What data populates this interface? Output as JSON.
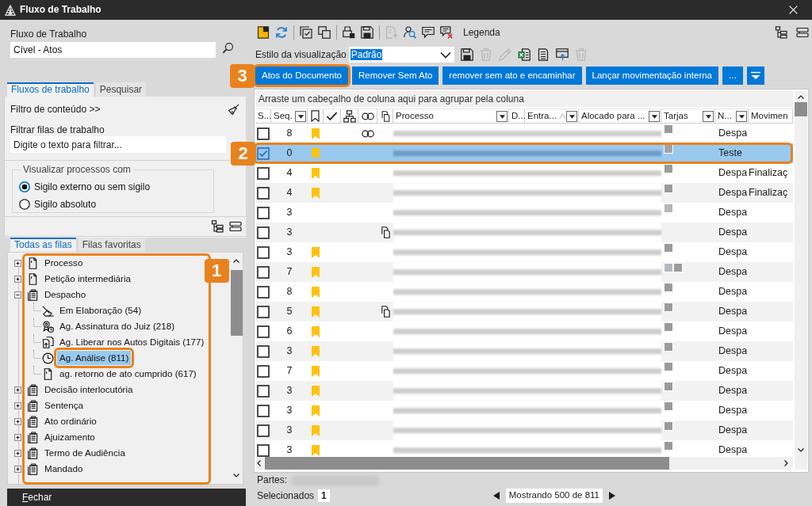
{
  "window": {
    "title": "Fluxo de Trabalho"
  },
  "workflow": {
    "label": "Fluxo de Trabalho",
    "value": "Cível - Atos"
  },
  "left_tabs": [
    {
      "label": "Fluxos de trabalho",
      "selected": true
    },
    {
      "label": "Pesquisar",
      "selected": false
    }
  ],
  "content_filter": {
    "label": "Filtro de conteúdo >>"
  },
  "queue_filter": {
    "label": "Filtrar filas de trabalho",
    "placeholder": "Digite o texto para filtrar..."
  },
  "visibility_group": {
    "legend": "Visualizar processos com",
    "options": [
      {
        "label": "Sigilo externo ou sem sigilo",
        "selected": true
      },
      {
        "label": "Sigilo absoluto",
        "selected": false
      }
    ]
  },
  "queue_tabs": [
    {
      "label": "Todas as filas",
      "selected": true
    },
    {
      "label": "Filas favoritas",
      "selected": false
    }
  ],
  "queue_tree": {
    "callout": "1",
    "items": [
      {
        "label": "Processo",
        "kind": "document",
        "expanded": false,
        "selected": false,
        "outlined": false
      },
      {
        "label": "Petição intermediária",
        "kind": "document",
        "expanded": false,
        "selected": false,
        "outlined": false
      },
      {
        "label": "Despacho",
        "kind": "clipboard",
        "expanded": true,
        "selected": false,
        "outlined": false,
        "children": [
          {
            "label": "Em Elaboração (54)",
            "kind": "draft",
            "selected": false,
            "outlined": false
          },
          {
            "label": "Ag. Assinatura do Juiz (218)",
            "kind": "signature",
            "selected": false,
            "outlined": false
          },
          {
            "label": "Ag. Liberar nos Autos Digitais (177)",
            "kind": "upload",
            "selected": false,
            "outlined": false
          },
          {
            "label": "Ag. Análise (811)",
            "kind": "clock",
            "selected": true,
            "outlined": true
          },
          {
            "label": "ag. retorno de ato cumprido (617)",
            "kind": "document",
            "selected": false,
            "outlined": false
          }
        ]
      },
      {
        "label": "Decisão interlocutória",
        "kind": "clipboard",
        "expanded": false,
        "selected": false,
        "outlined": false
      },
      {
        "label": "Sentença",
        "kind": "clipboard",
        "expanded": false,
        "selected": false,
        "outlined": false
      },
      {
        "label": "Ato ordinário",
        "kind": "clipboard",
        "expanded": false,
        "selected": false,
        "outlined": false
      },
      {
        "label": "Ajuizamento",
        "kind": "clipboard",
        "expanded": false,
        "selected": false,
        "outlined": false
      },
      {
        "label": "Termo de Audiência",
        "kind": "clipboard",
        "expanded": false,
        "selected": false,
        "outlined": false
      },
      {
        "label": "Mandado",
        "kind": "clipboard",
        "expanded": false,
        "selected": false,
        "outlined": false
      }
    ]
  },
  "footer": {
    "close_label": "Fechar"
  },
  "toolbar": [
    {
      "kind": "new",
      "disabled": false
    },
    {
      "kind": "refresh",
      "disabled": false
    },
    {
      "kind": "separator"
    },
    {
      "kind": "checklist",
      "disabled": false
    },
    {
      "kind": "windows",
      "disabled": false
    },
    {
      "kind": "separator"
    },
    {
      "kind": "print",
      "disabled": false
    },
    {
      "kind": "save",
      "disabled": false
    },
    {
      "kind": "separator"
    },
    {
      "kind": "export",
      "disabled": true
    },
    {
      "kind": "inspect",
      "disabled": false
    },
    {
      "kind": "comment",
      "disabled": false
    },
    {
      "kind": "uncomment",
      "disabled": false
    },
    {
      "kind": "label",
      "text": "Legenda"
    }
  ],
  "view_style": {
    "label": "Estilo da visualização",
    "value": "Padrão",
    "tools": [
      {
        "kind": "save",
        "disabled": false
      },
      {
        "kind": "delete",
        "disabled": true
      },
      {
        "kind": "edit",
        "disabled": true
      },
      {
        "kind": "excel",
        "disabled": false
      },
      {
        "kind": "document",
        "disabled": false
      },
      {
        "kind": "window",
        "disabled": false
      },
      {
        "kind": "delete",
        "disabled": true
      }
    ]
  },
  "action_buttons": [
    {
      "label": "Atos do Documento",
      "callout": "3"
    },
    {
      "label": "Remover Sem Ato"
    },
    {
      "label": "remover sem ato e encaminhar"
    },
    {
      "label": "Lançar movimentação interna"
    },
    {
      "label": "..."
    }
  ],
  "grid": {
    "group_hint": "Arraste um cabeçalho de coluna aqui para agrupar pela coluna",
    "columns": [
      {
        "kind": "text",
        "label": "S...",
        "filter": false,
        "sorted": false
      },
      {
        "kind": "text",
        "label": "Seq.",
        "filter": true,
        "sorted": false
      },
      {
        "kind": "bookmark",
        "filter": false,
        "sorted": false
      },
      {
        "kind": "check",
        "filter": false,
        "sorted": false
      },
      {
        "kind": "hierarchy",
        "filter": false,
        "sorted": false
      },
      {
        "kind": "link",
        "filter": false,
        "sorted": false
      },
      {
        "kind": "copy",
        "filter": false,
        "sorted": false
      },
      {
        "kind": "text",
        "label": "Processo",
        "filter": true,
        "sorted": false
      },
      {
        "kind": "text",
        "label": "D...",
        "filter": false,
        "sorted": false
      },
      {
        "kind": "text",
        "label": "Entra...",
        "filter": true,
        "sorted": true
      },
      {
        "kind": "text",
        "label": "Alocado para ...",
        "filter": true,
        "sorted": false
      },
      {
        "kind": "text",
        "label": "Tarjas",
        "filter": true,
        "sorted": false
      },
      {
        "kind": "text",
        "label": "N...",
        "filter": true,
        "sorted": false
      },
      {
        "kind": "text",
        "label": "Movimen",
        "filter": false,
        "sorted": false
      }
    ],
    "rows": [
      {
        "checked": false,
        "selected": false,
        "seq": "8",
        "bookmarked": true,
        "link": true,
        "copy": false,
        "tarjas": [
          {
            "color": "#9b9b9b"
          }
        ],
        "n": "Despa"
      },
      {
        "checked": true,
        "selected": true,
        "callout": "2",
        "seq": "0",
        "bookmarked": true,
        "link": false,
        "copy": false,
        "tarjas": [
          {
            "color": "#a3a3a3"
          }
        ],
        "n": "Teste"
      },
      {
        "checked": false,
        "selected": false,
        "seq": "4",
        "bookmarked": true,
        "link": false,
        "copy": false,
        "tarjas": [
          {
            "color": "#9b9b9b"
          }
        ],
        "n": "Despa",
        "movimen": "Finalizaç"
      },
      {
        "checked": false,
        "selected": false,
        "seq": "4",
        "bookmarked": true,
        "link": false,
        "copy": false,
        "tarjas": [
          {
            "color": "#9b9b9b"
          }
        ],
        "n": "Despa",
        "movimen": "Finalizaç"
      },
      {
        "checked": false,
        "selected": false,
        "seq": "3",
        "bookmarked": false,
        "link": false,
        "copy": false,
        "tarjas": [
          {
            "color": "#b3b8bd"
          }
        ],
        "n": "Despa"
      },
      {
        "checked": false,
        "selected": false,
        "seq": "3",
        "bookmarked": false,
        "link": false,
        "copy": true,
        "n": "Despa"
      },
      {
        "checked": false,
        "selected": false,
        "seq": "3",
        "bookmarked": true,
        "link": false,
        "copy": false,
        "tarjas": [
          {
            "color": "#9b9b9b"
          }
        ],
        "n": "Despa"
      },
      {
        "checked": false,
        "selected": false,
        "seq": "7",
        "bookmarked": true,
        "link": false,
        "copy": false,
        "tarjas": [
          {
            "color": "#b3b8bd"
          },
          {
            "color": "#9b9b9b"
          }
        ],
        "n": "Despa"
      },
      {
        "checked": false,
        "selected": false,
        "seq": "8",
        "bookmarked": true,
        "link": false,
        "copy": false,
        "tarjas": [
          {
            "color": "#9b9b9b"
          }
        ],
        "n": "Despa"
      },
      {
        "checked": false,
        "selected": false,
        "seq": "5",
        "bookmarked": true,
        "link": false,
        "copy": true,
        "tarjas": [
          {
            "color": "#9b9b9b"
          }
        ],
        "n": "Despa"
      },
      {
        "checked": false,
        "selected": false,
        "seq": "6",
        "bookmarked": true,
        "link": false,
        "copy": false,
        "tarjas": [
          {
            "color": "#9b9b9b"
          }
        ],
        "n": "Despa"
      },
      {
        "checked": false,
        "selected": false,
        "seq": "3",
        "bookmarked": true,
        "link": false,
        "copy": false,
        "tarjas": [
          {
            "color": "#9b9b9b"
          }
        ],
        "n": "Despa"
      },
      {
        "checked": false,
        "selected": false,
        "seq": "7",
        "bookmarked": true,
        "link": false,
        "copy": false,
        "tarjas": [
          {
            "color": "#9b9b9b"
          }
        ],
        "n": "Despa"
      },
      {
        "checked": false,
        "selected": false,
        "seq": "3",
        "bookmarked": true,
        "link": false,
        "copy": false,
        "tarjas": [
          {
            "color": "#9b9b9b"
          }
        ],
        "n": "Despa"
      },
      {
        "checked": false,
        "selected": false,
        "seq": "3",
        "bookmarked": true,
        "link": false,
        "copy": false,
        "tarjas": [
          {
            "color": "#9b9b9b"
          }
        ],
        "n": "Despa"
      },
      {
        "checked": false,
        "selected": false,
        "seq": "3",
        "bookmarked": true,
        "link": false,
        "copy": false,
        "tarjas": [
          {
            "color": "#9b9b9b"
          }
        ],
        "n": "Despa"
      },
      {
        "checked": false,
        "selected": false,
        "seq": "3",
        "bookmarked": true,
        "link": false,
        "copy": false,
        "tarjas": [
          {
            "color": "#9b9b9b"
          }
        ],
        "n": "Despa"
      }
    ]
  },
  "parties": {
    "label": "Partes:"
  },
  "status": {
    "selected_label": "Selecionados",
    "selected_count": "1",
    "paging": "Mostrando 500 de 811"
  }
}
